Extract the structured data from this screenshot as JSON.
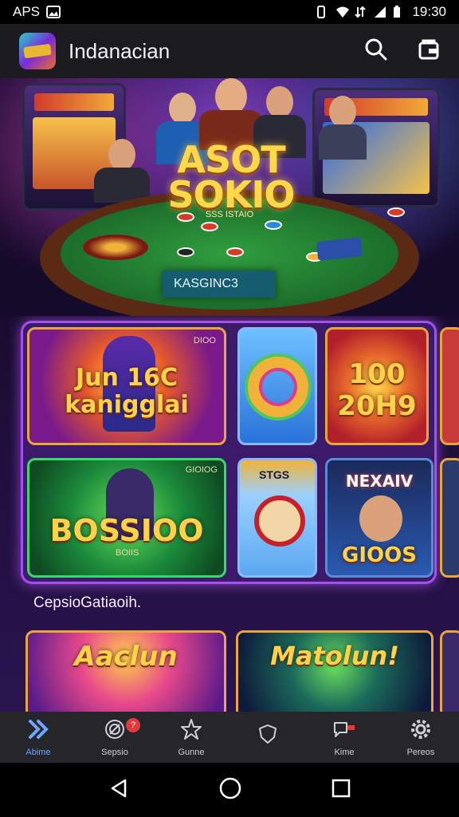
{
  "status_bar": {
    "left_text": "APS",
    "time": "19:30",
    "icons": [
      "image-icon",
      "vibrate-icon",
      "wifi-icon",
      "data-icon",
      "signal-icon",
      "battery-icon"
    ]
  },
  "app_bar": {
    "title": "Indanacian",
    "icons": [
      "app-logo",
      "search-icon",
      "wallet-icon"
    ]
  },
  "hero": {
    "title": "ASOT SOKIO",
    "subtitle": "SSS ISTAIO",
    "badge": "KASGINC3"
  },
  "grid": {
    "tiles": [
      {
        "title": "Jun 16C kanigglai",
        "corner": "DIOO"
      },
      {
        "title": "",
        "corner": ""
      },
      {
        "title": "100 20H9",
        "corner": ""
      },
      {
        "title": "BOSSIOO",
        "corner": "GIOIOG",
        "sub": "BOIIS"
      },
      {
        "title": "",
        "corner": "STGS"
      },
      {
        "title": "GIOOS",
        "corner": "NEXAIV"
      }
    ]
  },
  "section": {
    "label": "CepsioGatiaoih."
  },
  "bottom_tiles": [
    {
      "title": "Aaclun"
    },
    {
      "title": "Matolun!"
    }
  ],
  "bottom_nav": {
    "items": [
      {
        "label": "Abime",
        "icon": "home-icon",
        "active": true
      },
      {
        "label": "Sepsio",
        "icon": "target-icon",
        "badge": "?"
      },
      {
        "label": "Gunne",
        "icon": "star-icon"
      },
      {
        "label": "",
        "icon": "shield-icon"
      },
      {
        "label": "Kime",
        "icon": "chat-icon"
      },
      {
        "label": "Pereos",
        "icon": "settings-icon"
      }
    ]
  },
  "colors": {
    "accent": "#6aa8ff",
    "gold": "#ffd24a",
    "panel_border": "#a54ff0",
    "app_bar": "#1b1b1f",
    "bottom_nav": "#26252a"
  }
}
